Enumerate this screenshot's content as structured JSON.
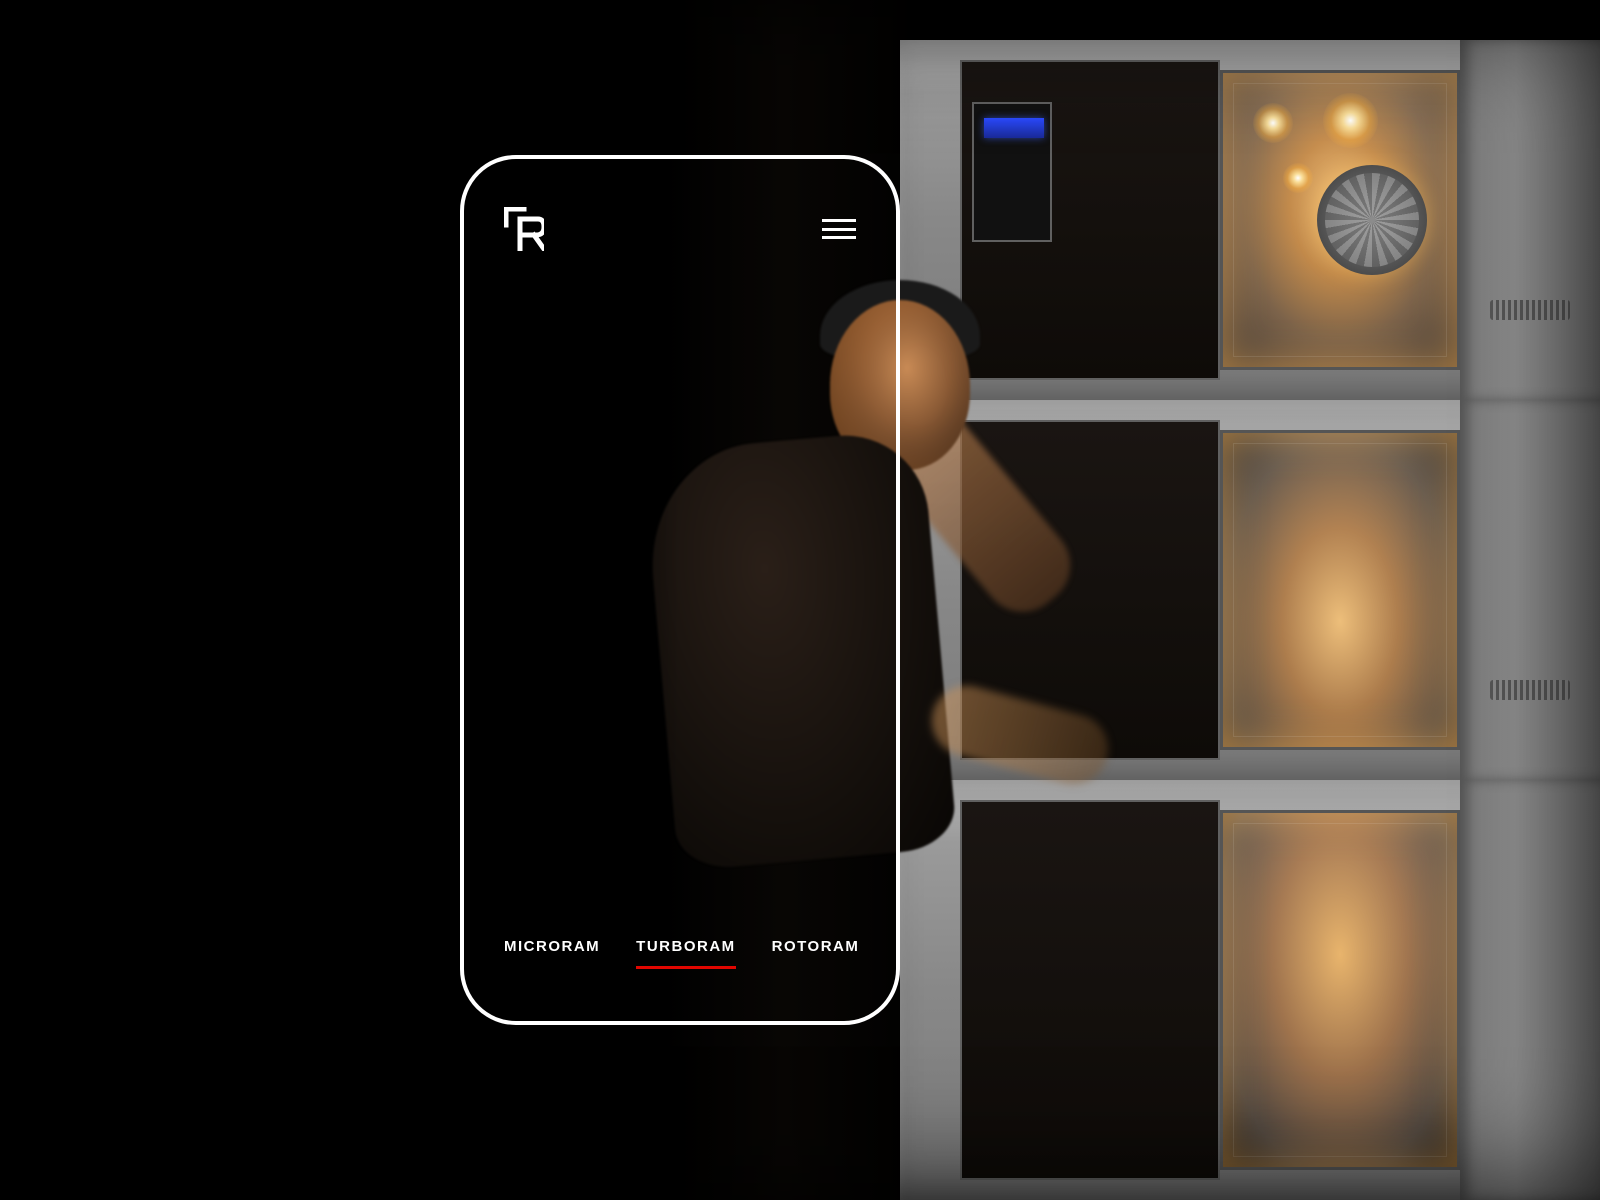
{
  "brand": {
    "logo_name": "R-logo"
  },
  "colors": {
    "accent": "#e10600",
    "frame": "#ffffff",
    "bg": "#000000"
  },
  "nav": {
    "tabs": [
      {
        "label": "MICRORAM",
        "active": false
      },
      {
        "label": "TURBORAM",
        "active": true
      },
      {
        "label": "ROTORAM",
        "active": false
      }
    ]
  }
}
